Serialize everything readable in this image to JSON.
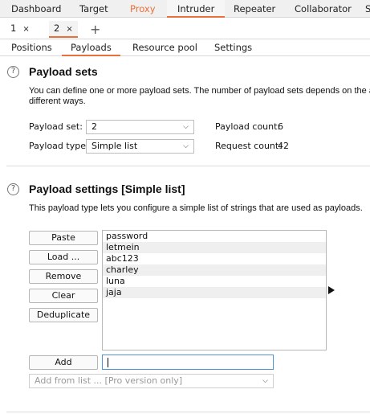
{
  "top_tabs": [
    "Dashboard",
    "Target",
    "Proxy",
    "Intruder",
    "Repeater",
    "Collaborator",
    "S"
  ],
  "attack_tabs": [
    {
      "label": "1",
      "close": "×"
    },
    {
      "label": "2",
      "close": "×"
    }
  ],
  "new_tab": "+",
  "sub_tabs": [
    "Positions",
    "Payloads",
    "Resource pool",
    "Settings"
  ],
  "payload_sets": {
    "title": "Payload sets",
    "desc_line1": "You can define one or more payload sets. The number of payload sets depends on the a",
    "desc_line2": "different ways.",
    "set_label": "Payload set:",
    "set_value": "2",
    "type_label": "Payload type:",
    "type_value": "Simple list",
    "count_label": "Payload count:",
    "count_value": "6",
    "request_label": "Request count:",
    "request_value": "42"
  },
  "payload_settings": {
    "title": "Payload settings [Simple list]",
    "desc": "This payload type lets you configure a simple list of strings that are used as payloads.",
    "buttons": [
      "Paste",
      "Load ...",
      "Remove",
      "Clear",
      "Deduplicate"
    ],
    "items": [
      "password",
      "letmein",
      "abc123",
      "charley",
      "luna",
      "jaja"
    ],
    "add_button": "Add",
    "add_input_value": "",
    "add_from_list": "Add from list ... [Pro version only]"
  },
  "help_glyph": "?",
  "chevron_glyph": "⌵",
  "accent_color": "#e8703a"
}
